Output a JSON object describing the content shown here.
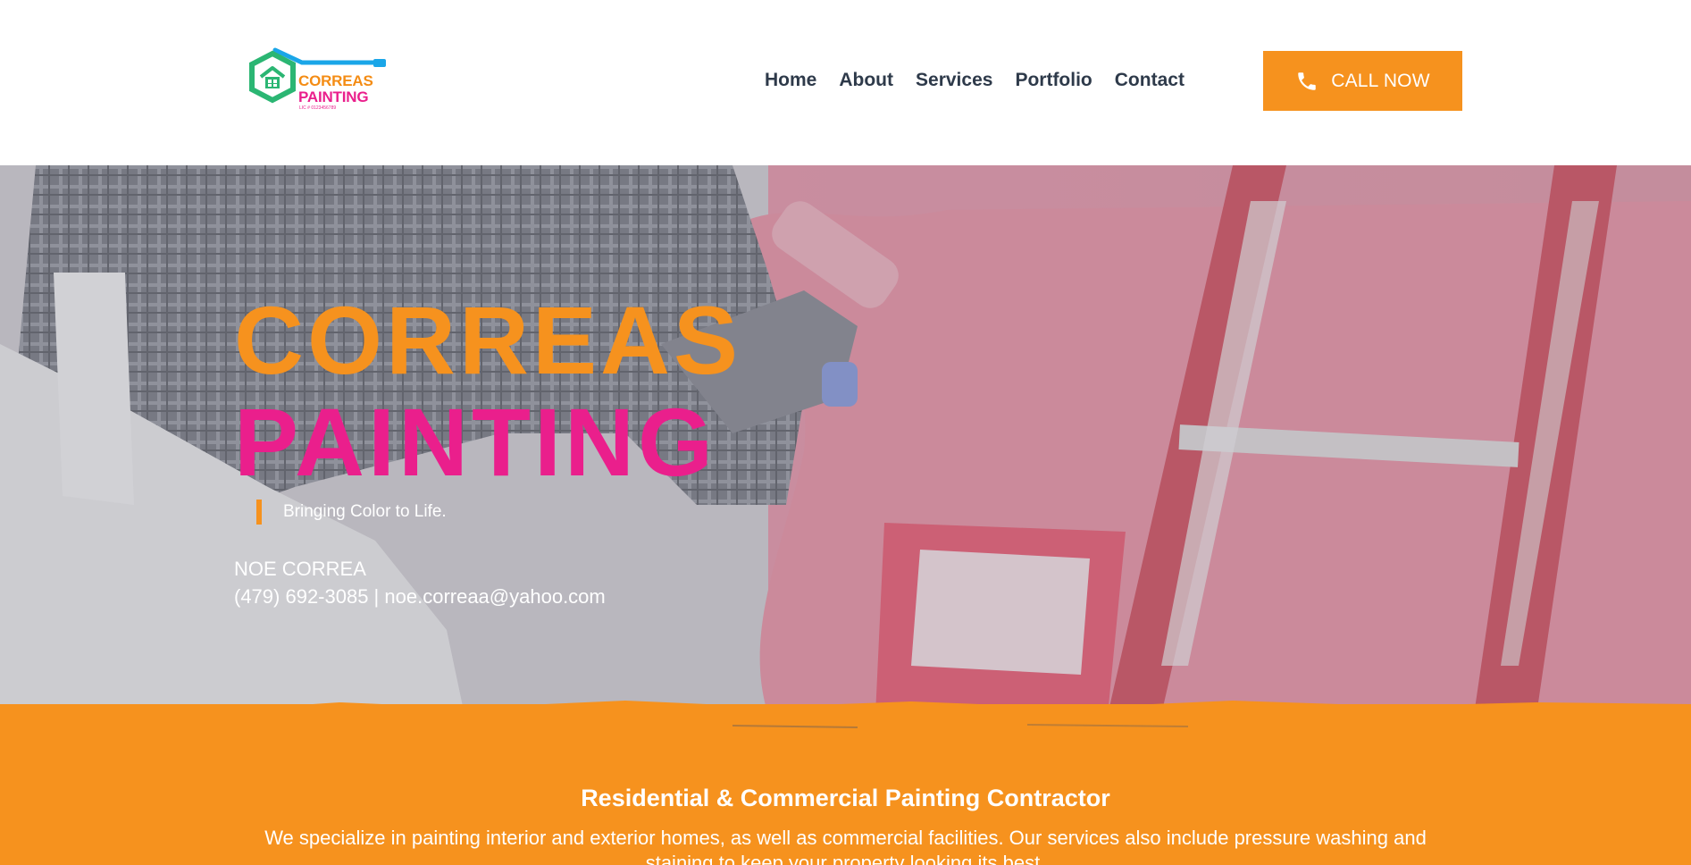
{
  "header": {
    "logo": {
      "line1": "CORREAS",
      "line2": "PAINTING",
      "license": "LIC # 0123456789"
    },
    "nav": [
      {
        "label": "Home"
      },
      {
        "label": "About"
      },
      {
        "label": "Services"
      },
      {
        "label": "Portfolio"
      },
      {
        "label": "Contact"
      }
    ],
    "call_button": {
      "label": "CALL NOW",
      "icon": "phone-icon"
    }
  },
  "hero": {
    "title_line1": "CORREAS",
    "title_line2": "PAINTING",
    "tagline": "Bringing Color to Life.",
    "owner_name": "NOE CORREA",
    "contact_line": "(479) 692-3085 | noe.correaa@yahoo.com"
  },
  "intro": {
    "heading": "Residential & Commercial Painting Contractor",
    "description": "We specialize in painting interior and exterior homes, as well as commercial facilities. Our services also include pressure washing and staining to keep your property looking its best."
  },
  "colors": {
    "orange": "#f6921e",
    "magenta": "#ea1f8c",
    "nav_text": "#2e3a4a",
    "logo_blue": "#1aa6e8",
    "logo_green": "#2bb673"
  }
}
